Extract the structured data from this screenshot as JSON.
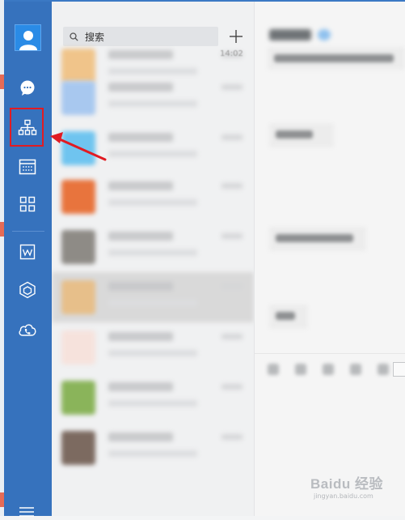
{
  "app": {
    "search": {
      "placeholder": "搜索"
    },
    "chat_list": {
      "top_time": "14:02",
      "rows": [
        {
          "avatar_color": "#f0c48a"
        },
        {
          "avatar_color": "#a8c8ef"
        },
        {
          "avatar_color": "#6fc4ef"
        },
        {
          "avatar_color": "#e8743d"
        },
        {
          "avatar_color": "#8e8b86"
        },
        {
          "avatar_color": "#e7bf8a",
          "selected": true
        },
        {
          "avatar_color": "#f6e2dc"
        },
        {
          "avatar_color": "#8ab45a"
        },
        {
          "avatar_color": "#7c6a60"
        }
      ]
    },
    "sidebar": {
      "items": [
        {
          "icon": "chat-bubble-icon"
        },
        {
          "icon": "org-structure-icon",
          "highlighted": true
        },
        {
          "icon": "calendar-icon"
        },
        {
          "icon": "apps-grid-icon"
        },
        {
          "icon": "document-w-icon"
        },
        {
          "icon": "cube-icon"
        },
        {
          "icon": "cloud-phone-icon"
        },
        {
          "icon": "menu-icon"
        }
      ]
    },
    "colors": {
      "sidebar": "#3672bd",
      "highlight": "#e11b22",
      "arrow": "#e11b22"
    }
  },
  "watermark": {
    "brand": "Baidu 经验",
    "url": "jingyan.baidu.com"
  }
}
